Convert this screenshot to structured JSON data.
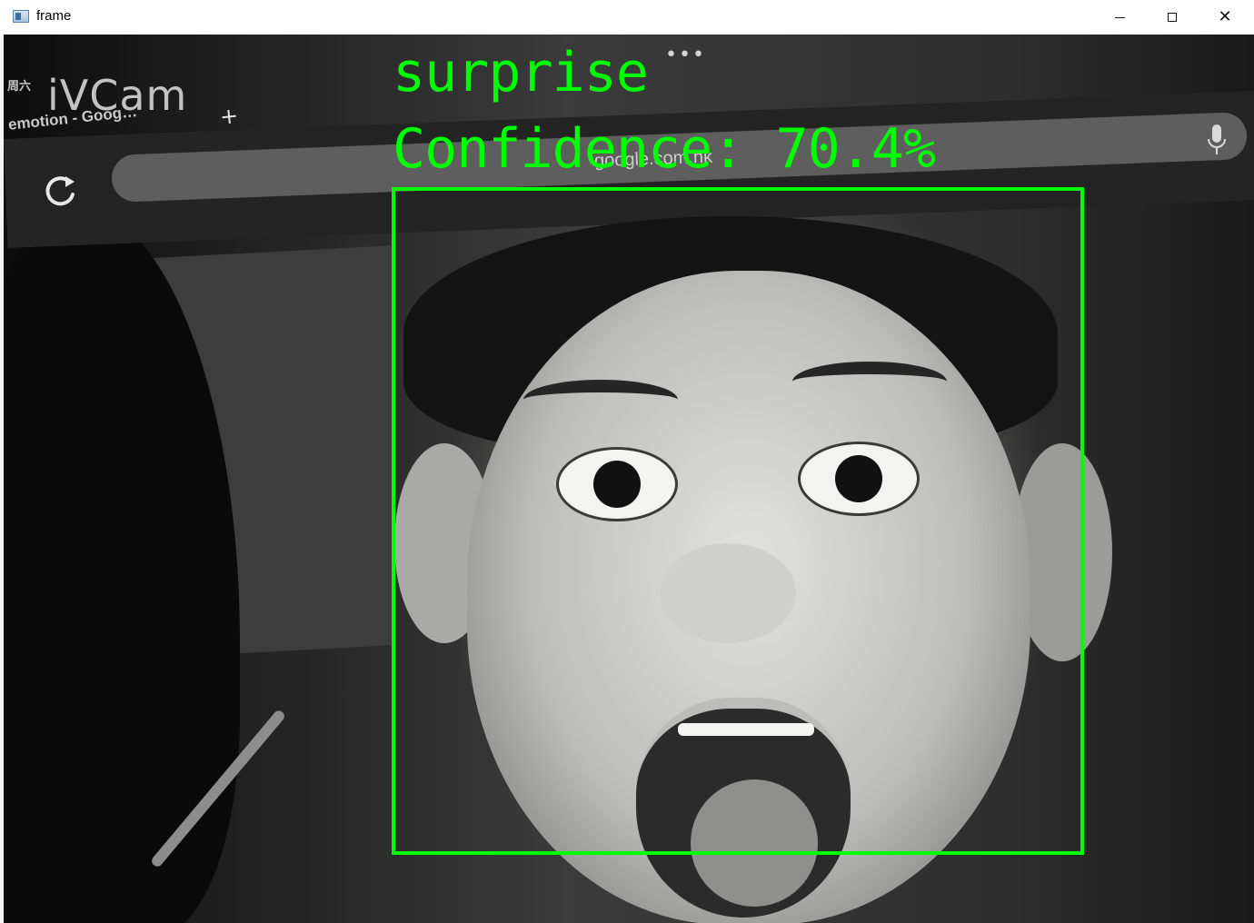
{
  "window": {
    "title": "frame",
    "controls": {
      "minimize": "minimize",
      "maximize": "maximize",
      "close": "close"
    }
  },
  "video_frame": {
    "watermark": "iVCam",
    "browser_overlay": {
      "weekday": "周六",
      "tab_label": "emotion - Goog…",
      "url": "google.com.hk"
    }
  },
  "detection": {
    "emotion": "surprise",
    "confidence_text": "Confidence: 70.4%",
    "confidence_value": 70.4,
    "box_color": "#00ff00"
  }
}
